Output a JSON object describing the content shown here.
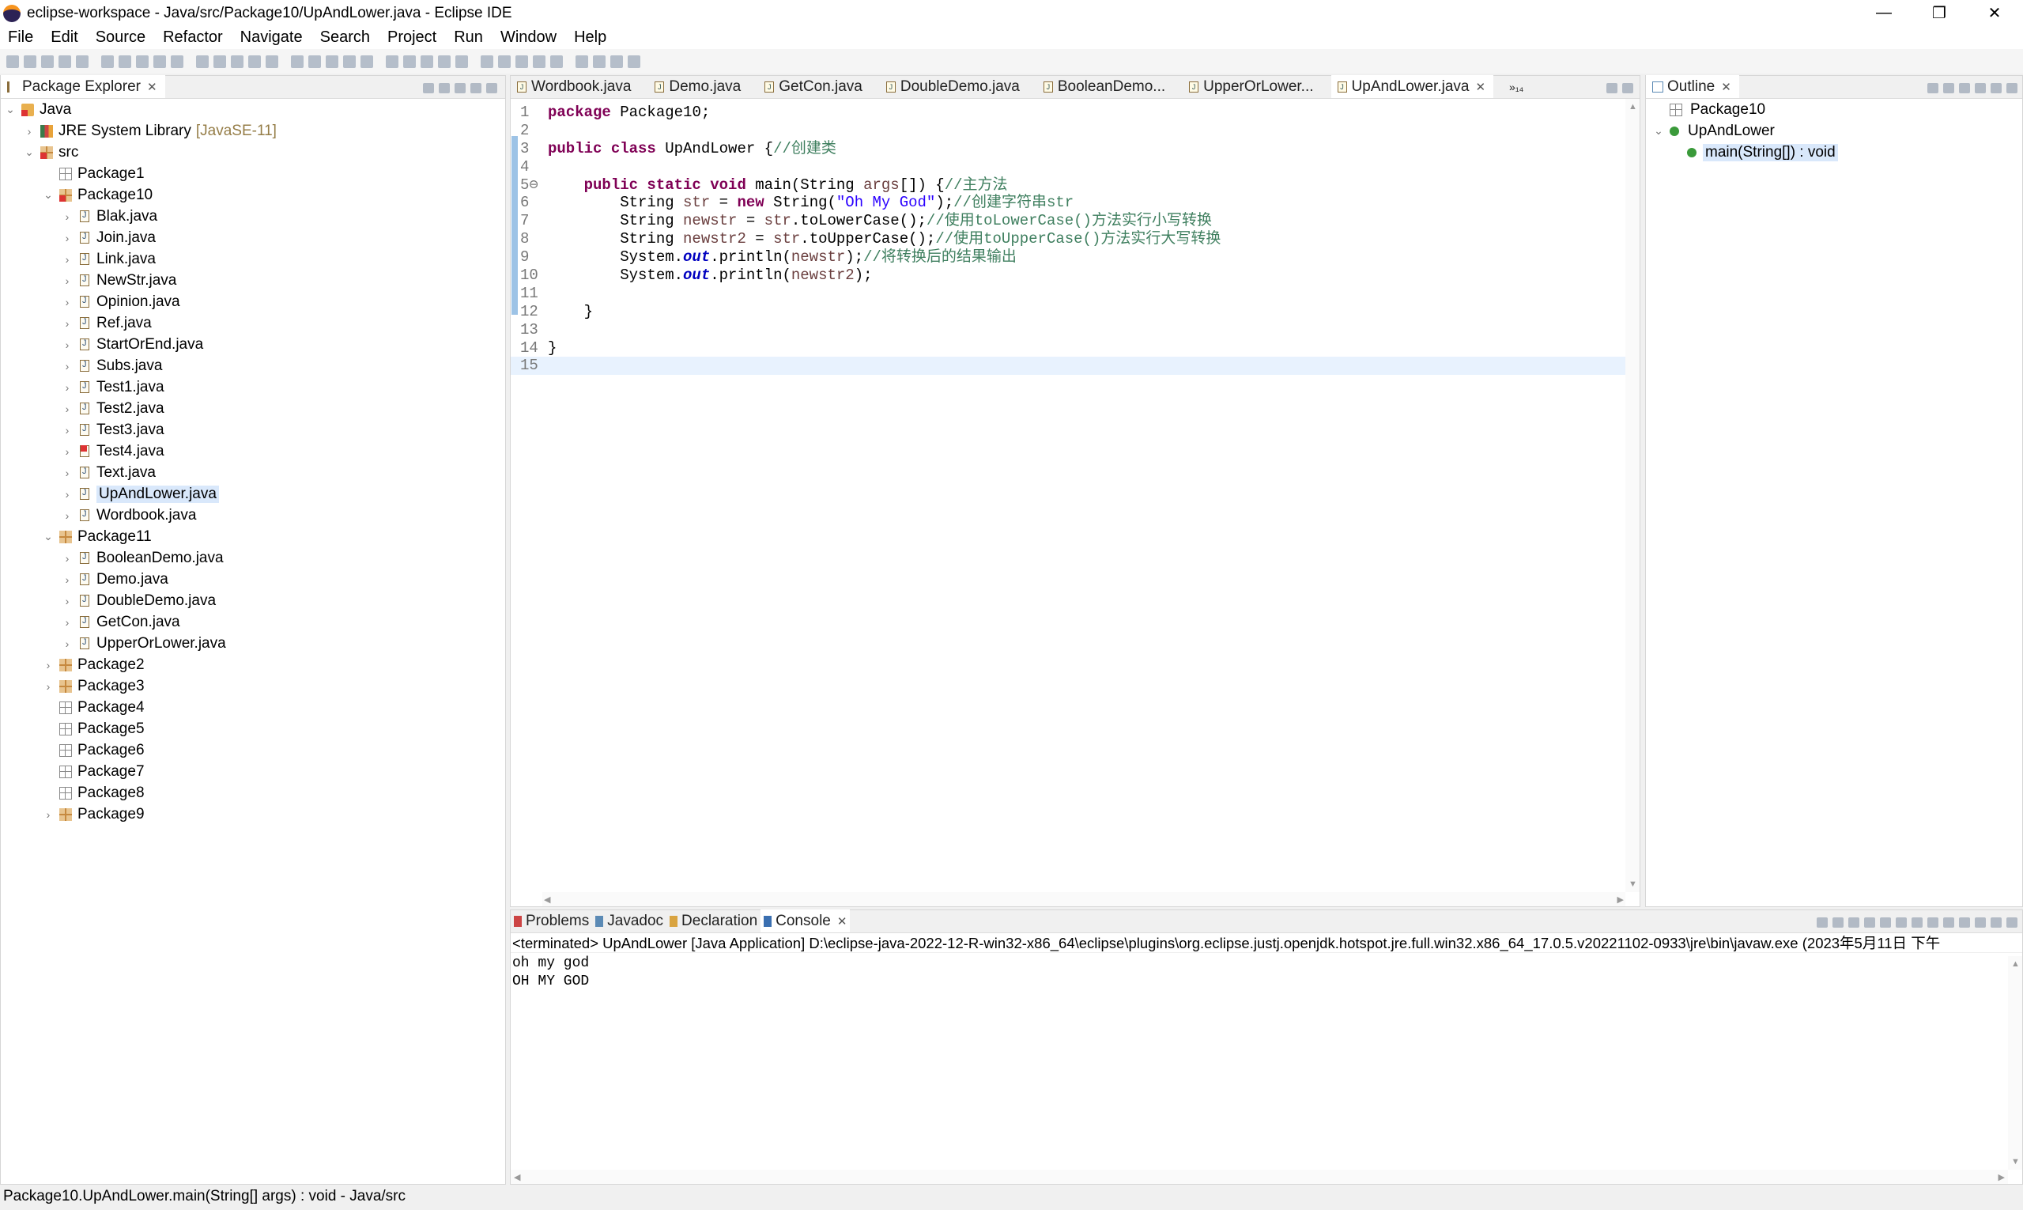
{
  "window": {
    "title": "eclipse-workspace - Java/src/Package10/UpAndLower.java - Eclipse IDE",
    "minimize": "—",
    "restore": "❐",
    "close": "✕"
  },
  "menu": [
    "File",
    "Edit",
    "Source",
    "Refactor",
    "Navigate",
    "Search",
    "Project",
    "Run",
    "Window",
    "Help"
  ],
  "package_explorer": {
    "title": "Package Explorer",
    "tree": [
      {
        "label": "Java",
        "level": 0,
        "twisty": "open",
        "icon": "project"
      },
      {
        "label": "JRE System Library",
        "decor": "[JavaSE-11]",
        "level": 1,
        "twisty": "closed",
        "icon": "library"
      },
      {
        "label": "src",
        "level": 1,
        "twisty": "open",
        "icon": "source-folder-error"
      },
      {
        "label": "Package1",
        "level": 2,
        "twisty": "none",
        "icon": "package-empty"
      },
      {
        "label": "Package10",
        "level": 2,
        "twisty": "open",
        "icon": "package-error"
      },
      {
        "label": "Blak.java",
        "level": 3,
        "twisty": "closed",
        "icon": "java-file"
      },
      {
        "label": "Join.java",
        "level": 3,
        "twisty": "closed",
        "icon": "java-file"
      },
      {
        "label": "Link.java",
        "level": 3,
        "twisty": "closed",
        "icon": "java-file"
      },
      {
        "label": "NewStr.java",
        "level": 3,
        "twisty": "closed",
        "icon": "java-file"
      },
      {
        "label": "Opinion.java",
        "level": 3,
        "twisty": "closed",
        "icon": "java-file"
      },
      {
        "label": "Ref.java",
        "level": 3,
        "twisty": "closed",
        "icon": "java-file"
      },
      {
        "label": "StartOrEnd.java",
        "level": 3,
        "twisty": "closed",
        "icon": "java-file"
      },
      {
        "label": "Subs.java",
        "level": 3,
        "twisty": "closed",
        "icon": "java-file"
      },
      {
        "label": "Test1.java",
        "level": 3,
        "twisty": "closed",
        "icon": "java-file"
      },
      {
        "label": "Test2.java",
        "level": 3,
        "twisty": "closed",
        "icon": "java-file"
      },
      {
        "label": "Test3.java",
        "level": 3,
        "twisty": "closed",
        "icon": "java-file"
      },
      {
        "label": "Test4.java",
        "level": 3,
        "twisty": "closed",
        "icon": "java-file-error"
      },
      {
        "label": "Text.java",
        "level": 3,
        "twisty": "closed",
        "icon": "java-file"
      },
      {
        "label": "UpAndLower.java",
        "level": 3,
        "twisty": "closed",
        "icon": "java-file",
        "selected": true
      },
      {
        "label": "Wordbook.java",
        "level": 3,
        "twisty": "closed",
        "icon": "java-file"
      },
      {
        "label": "Package11",
        "level": 2,
        "twisty": "open",
        "icon": "package"
      },
      {
        "label": "BooleanDemo.java",
        "level": 3,
        "twisty": "closed",
        "icon": "java-file"
      },
      {
        "label": "Demo.java",
        "level": 3,
        "twisty": "closed",
        "icon": "java-file"
      },
      {
        "label": "DoubleDemo.java",
        "level": 3,
        "twisty": "closed",
        "icon": "java-file"
      },
      {
        "label": "GetCon.java",
        "level": 3,
        "twisty": "closed",
        "icon": "java-file"
      },
      {
        "label": "UpperOrLower.java",
        "level": 3,
        "twisty": "closed",
        "icon": "java-file"
      },
      {
        "label": "Package2",
        "level": 2,
        "twisty": "closed",
        "icon": "package"
      },
      {
        "label": "Package3",
        "level": 2,
        "twisty": "closed",
        "icon": "package"
      },
      {
        "label": "Package4",
        "level": 2,
        "twisty": "none",
        "icon": "package-empty"
      },
      {
        "label": "Package5",
        "level": 2,
        "twisty": "none",
        "icon": "package-empty"
      },
      {
        "label": "Package6",
        "level": 2,
        "twisty": "none",
        "icon": "package-empty"
      },
      {
        "label": "Package7",
        "level": 2,
        "twisty": "none",
        "icon": "package-empty"
      },
      {
        "label": "Package8",
        "level": 2,
        "twisty": "none",
        "icon": "package-empty"
      },
      {
        "label": "Package9",
        "level": 2,
        "twisty": "closed",
        "icon": "package"
      }
    ]
  },
  "editor": {
    "tabs": [
      {
        "label": "Wordbook.java"
      },
      {
        "label": "Demo.java"
      },
      {
        "label": "GetCon.java"
      },
      {
        "label": "DoubleDemo.java"
      },
      {
        "label": "BooleanDemo..."
      },
      {
        "label": "UpperOrLower..."
      },
      {
        "label": "UpAndLower.java",
        "active": true
      }
    ],
    "overflow": "»₁₄",
    "lines": [
      [
        [
          "package",
          "kw"
        ],
        [
          " Package10;",
          "pl"
        ]
      ],
      [],
      [
        [
          "public class",
          "kw"
        ],
        [
          " UpAndLower {",
          "pl"
        ],
        [
          "//创建类",
          "cm"
        ]
      ],
      [],
      [
        [
          "    "
        ],
        [
          "public static void",
          "kw"
        ],
        [
          " main(String ",
          "pl"
        ],
        [
          "args",
          "vr"
        ],
        [
          "[]) {",
          "pl"
        ],
        [
          "//主方法",
          "cm"
        ]
      ],
      [
        [
          "        String ",
          "pl"
        ],
        [
          "str",
          "vr"
        ],
        [
          " = ",
          "pl"
        ],
        [
          "new",
          "kw"
        ],
        [
          " String(",
          "pl"
        ],
        [
          "\"Oh My God\"",
          "st"
        ],
        [
          ");",
          "pl"
        ],
        [
          "//创建字符串str",
          "cm"
        ]
      ],
      [
        [
          "        String ",
          "pl"
        ],
        [
          "newstr",
          "vr"
        ],
        [
          " = ",
          "pl"
        ],
        [
          "str",
          "vr"
        ],
        [
          ".toLowerCase();",
          "pl"
        ],
        [
          "//使用toLowerCase()方法实行小写转换",
          "cm"
        ]
      ],
      [
        [
          "        String ",
          "pl"
        ],
        [
          "newstr2",
          "vr"
        ],
        [
          " = ",
          "pl"
        ],
        [
          "str",
          "vr"
        ],
        [
          ".toUpperCase();",
          "pl"
        ],
        [
          "//使用toUpperCase()方法实行大写转换",
          "cm"
        ]
      ],
      [
        [
          "        System.",
          "pl"
        ],
        [
          "out",
          "fd"
        ],
        [
          ".println(",
          "pl"
        ],
        [
          "newstr",
          "vr"
        ],
        [
          ");",
          "pl"
        ],
        [
          "//将转换后的结果输出",
          "cm"
        ]
      ],
      [
        [
          "        System.",
          "pl"
        ],
        [
          "out",
          "fd"
        ],
        [
          ".println(",
          "pl"
        ],
        [
          "newstr2",
          "vr"
        ],
        [
          ");",
          "pl"
        ]
      ],
      [],
      [
        [
          "    }",
          "pl"
        ]
      ],
      [],
      [
        [
          "}",
          "pl"
        ]
      ],
      []
    ]
  },
  "outline": {
    "title": "Outline",
    "items": [
      {
        "label": "Package10",
        "level": 0
      },
      {
        "label": "UpAndLower",
        "level": 0
      },
      {
        "label": "main(String[]) : void",
        "level": 1,
        "selected": true
      }
    ]
  },
  "bottom": {
    "tabs": [
      {
        "label": "Problems"
      },
      {
        "label": "Javadoc"
      },
      {
        "label": "Declaration"
      },
      {
        "label": "Console",
        "active": true
      }
    ],
    "console_header": "<terminated> UpAndLower [Java Application] D:\\eclipse-java-2022-12-R-win32-x86_64\\eclipse\\plugins\\org.eclipse.justj.openjdk.hotspot.jre.full.win32.x86_64_17.0.5.v20221102-0933\\jre\\bin\\javaw.exe  (2023年5月11日 下午",
    "output": [
      "oh my god",
      "OH MY GOD"
    ]
  },
  "status": {
    "text": "Package10.UpAndLower.main(String[] args) : void - Java/src"
  }
}
